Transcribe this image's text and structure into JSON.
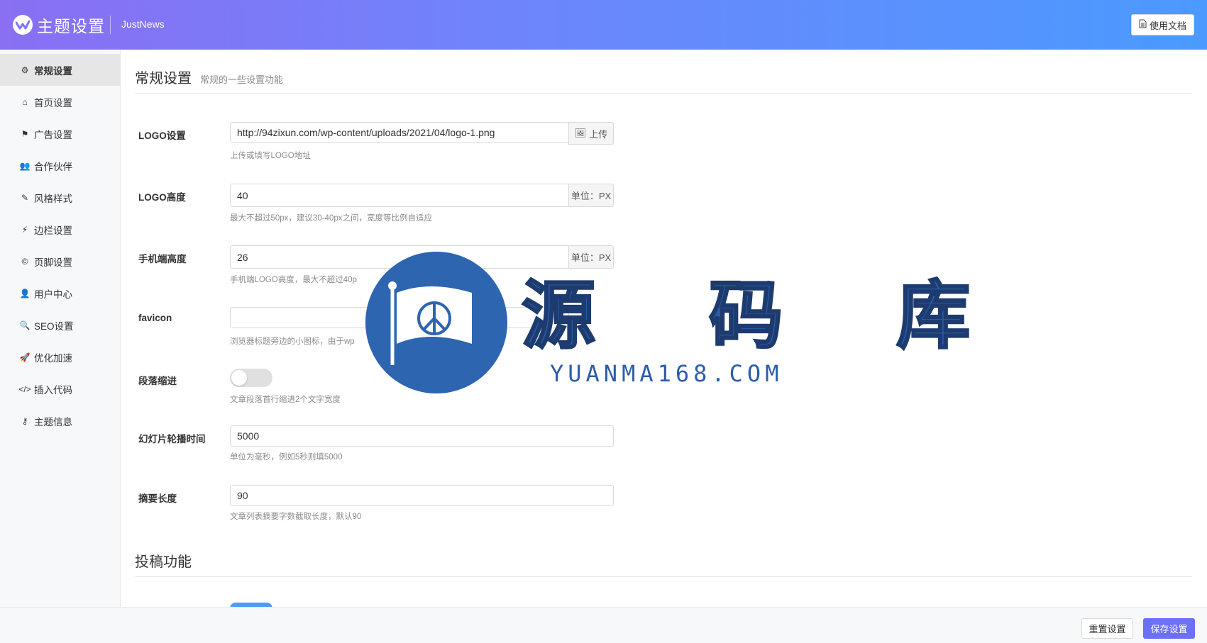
{
  "header": {
    "title": "主题设置",
    "subtitle": "JustNews",
    "docs_label": "使用文档"
  },
  "sidebar": {
    "items": [
      {
        "label": "常规设置",
        "icon": "gear-icon",
        "active": true
      },
      {
        "label": "首页设置",
        "icon": "home-icon"
      },
      {
        "label": "广告设置",
        "icon": "flag-icon"
      },
      {
        "label": "合作伙伴",
        "icon": "users-icon"
      },
      {
        "label": "风格样式",
        "icon": "magic-wand-icon"
      },
      {
        "label": "边栏设置",
        "icon": "plug-icon"
      },
      {
        "label": "页脚设置",
        "icon": "copyright-icon"
      },
      {
        "label": "用户中心",
        "icon": "user-icon"
      },
      {
        "label": "SEO设置",
        "icon": "search-icon"
      },
      {
        "label": "优化加速",
        "icon": "rocket-icon"
      },
      {
        "label": "插入代码",
        "icon": "code-icon"
      },
      {
        "label": "主题信息",
        "icon": "key-icon"
      }
    ]
  },
  "section": {
    "title": "常规设置",
    "desc": "常规的一些设置功能"
  },
  "form": {
    "logo": {
      "label": "LOGO设置",
      "value": "http://94zixun.com/wp-content/uploads/2021/04/logo-1.png",
      "addon": "上传",
      "help": "上传或填写LOGO地址"
    },
    "logo_height": {
      "label": "LOGO高度",
      "value": "40",
      "addon": "单位：PX",
      "help": "最大不超过50px，建议30-40px之间，宽度等比例自适应"
    },
    "mobile_height": {
      "label": "手机端高度",
      "value": "26",
      "addon": "单位：PX",
      "help": "手机端LOGO高度，最大不超过40p"
    },
    "favicon": {
      "label": "favicon",
      "value": "",
      "help": "浏览器标题旁边的小图标，由于wp"
    },
    "indent": {
      "label": "段落缩进",
      "checked": false,
      "help": "文章段落首行缩进2个文字宽度"
    },
    "slide_time": {
      "label": "幻灯片轮播时间",
      "value": "5000",
      "help": "单位为毫秒，例如5秒则填5000"
    },
    "excerpt_length": {
      "label": "摘要长度",
      "value": "90",
      "help": "文章列表摘要字数截取长度，默认90"
    }
  },
  "section2": {
    "title": "投稿功能"
  },
  "footer": {
    "reset_label": "重置设置",
    "save_label": "保存设置"
  },
  "watermark": {
    "text": "源 码 库",
    "url": "YUANMA168.COM"
  },
  "colors": {
    "header_start": "#8a6ff3",
    "header_end": "#4a9aff",
    "save_button": "#6c6ff8",
    "toggle_on": "#4d9bf8"
  }
}
